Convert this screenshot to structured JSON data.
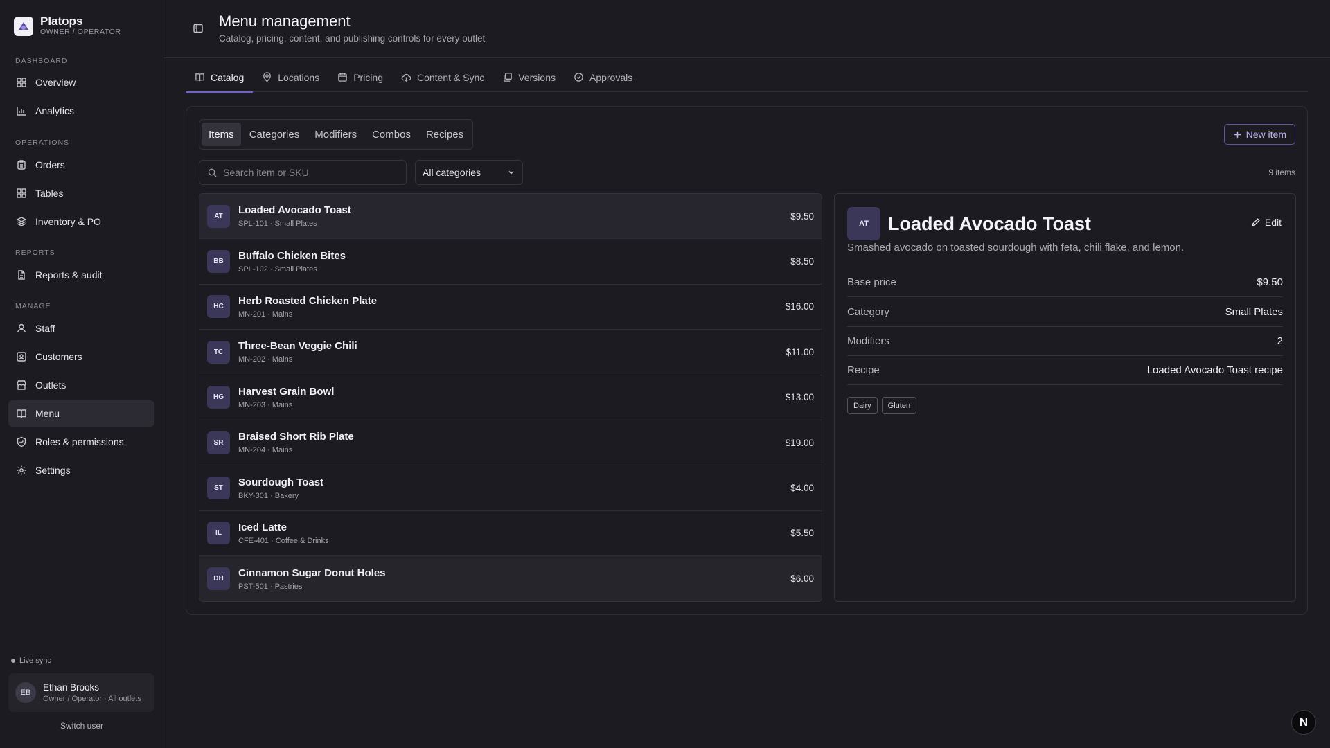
{
  "brand": {
    "name": "Platops",
    "subtitle": "OWNER / OPERATOR"
  },
  "sidebar": {
    "sections": {
      "dashboard": "DASHBOARD",
      "operations": "OPERATIONS",
      "reports": "REPORTS",
      "manage": "MANAGE"
    },
    "items": [
      {
        "label": "Overview",
        "icon": "grid-icon"
      },
      {
        "label": "Analytics",
        "icon": "bar-chart-icon"
      },
      {
        "label": "Orders",
        "icon": "clipboard-icon"
      },
      {
        "label": "Tables",
        "icon": "tables-grid-icon"
      },
      {
        "label": "Inventory & PO",
        "icon": "layers-icon"
      },
      {
        "label": "Reports & audit",
        "icon": "document-icon"
      },
      {
        "label": "Staff",
        "icon": "user-icon"
      },
      {
        "label": "Customers",
        "icon": "contact-icon"
      },
      {
        "label": "Outlets",
        "icon": "store-icon"
      },
      {
        "label": "Menu",
        "icon": "book-icon",
        "active": true
      },
      {
        "label": "Roles & permissions",
        "icon": "shield-icon"
      },
      {
        "label": "Settings",
        "icon": "gear-icon"
      }
    ],
    "live_sync": "Live sync",
    "user": {
      "initials": "EB",
      "name": "Ethan Brooks",
      "role": "Owner / Operator · All outlets"
    },
    "switch_user": "Switch user"
  },
  "header": {
    "title": "Menu management",
    "subtitle": "Catalog, pricing, content, and publishing controls for every outlet"
  },
  "tabs": [
    {
      "label": "Catalog",
      "icon": "book-icon",
      "active": true
    },
    {
      "label": "Locations",
      "icon": "map-pin-icon"
    },
    {
      "label": "Pricing",
      "icon": "calendar-icon"
    },
    {
      "label": "Content & Sync",
      "icon": "cloud-sync-icon"
    },
    {
      "label": "Versions",
      "icon": "copy-icon"
    },
    {
      "label": "Approvals",
      "icon": "check-circle-icon"
    }
  ],
  "catalog": {
    "subtabs": [
      "Items",
      "Categories",
      "Modifiers",
      "Combos",
      "Recipes"
    ],
    "active_subtab": "Items",
    "new_item_label": "New item",
    "search_placeholder": "Search item or SKU",
    "category_filter": "All categories",
    "count_label": "9 items",
    "items": [
      {
        "initials": "AT",
        "name": "Loaded Avocado Toast",
        "meta": "SPL-101 · Small Plates",
        "price": "$9.50",
        "selected": true
      },
      {
        "initials": "BB",
        "name": "Buffalo Chicken Bites",
        "meta": "SPL-102 · Small Plates",
        "price": "$8.50"
      },
      {
        "initials": "HC",
        "name": "Herb Roasted Chicken Plate",
        "meta": "MN-201 · Mains",
        "price": "$16.00"
      },
      {
        "initials": "TC",
        "name": "Three-Bean Veggie Chili",
        "meta": "MN-202 · Mains",
        "price": "$11.00"
      },
      {
        "initials": "HG",
        "name": "Harvest Grain Bowl",
        "meta": "MN-203 · Mains",
        "price": "$13.00"
      },
      {
        "initials": "SR",
        "name": "Braised Short Rib Plate",
        "meta": "MN-204 · Mains",
        "price": "$19.00"
      },
      {
        "initials": "ST",
        "name": "Sourdough Toast",
        "meta": "BKY-301 · Bakery",
        "price": "$4.00"
      },
      {
        "initials": "IL",
        "name": "Iced Latte",
        "meta": "CFE-401 · Coffee & Drinks",
        "price": "$5.50"
      },
      {
        "initials": "DH",
        "name": "Cinnamon Sugar Donut Holes",
        "meta": "PST-501 · Pastries",
        "price": "$6.00",
        "hover": true
      }
    ]
  },
  "detail": {
    "initials": "AT",
    "title": "Loaded Avocado Toast",
    "edit_label": "Edit",
    "description": "Smashed avocado on toasted sourdough with feta, chili flake, and lemon.",
    "fields": [
      {
        "key": "Base price",
        "value": "$9.50"
      },
      {
        "key": "Category",
        "value": "Small Plates"
      },
      {
        "key": "Modifiers",
        "value": "2"
      },
      {
        "key": "Recipe",
        "value": "Loaded Avocado Toast recipe"
      }
    ],
    "tags": [
      "Dairy",
      "Gluten"
    ]
  },
  "fab_label": "N",
  "colors": {
    "accent": "#6d64c9",
    "background": "#1c1b21",
    "badge": "#3a3759"
  }
}
